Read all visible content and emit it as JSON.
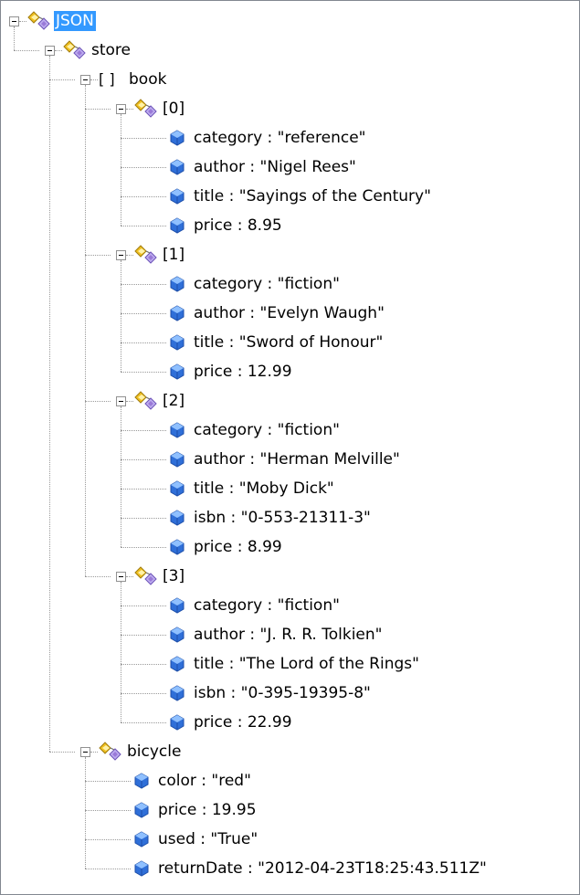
{
  "tree": {
    "root": "JSON",
    "store": "store",
    "book": "book",
    "array_glyph": "[ ]",
    "books": [
      {
        "index": "[0]",
        "props": [
          "category : \"reference\"",
          "author : \"Nigel Rees\"",
          "title : \"Sayings of the Century\"",
          "price : 8.95"
        ]
      },
      {
        "index": "[1]",
        "props": [
          "category : \"fiction\"",
          "author : \"Evelyn Waugh\"",
          "title : \"Sword of Honour\"",
          "price : 12.99"
        ]
      },
      {
        "index": "[2]",
        "props": [
          "category : \"fiction\"",
          "author : \"Herman Melville\"",
          "title : \"Moby Dick\"",
          "isbn : \"0-553-21311-3\"",
          "price : 8.99"
        ]
      },
      {
        "index": "[3]",
        "props": [
          "category : \"fiction\"",
          "author : \"J. R. R. Tolkien\"",
          "title : \"The Lord of the Rings\"",
          "isbn : \"0-395-19395-8\"",
          "price : 22.99"
        ]
      }
    ],
    "bicycle": "bicycle",
    "bicycle_props": [
      "color : \"red\"",
      "price : 19.95",
      "used : \"True\"",
      "returnDate : \"2012-04-23T18:25:43.511Z\""
    ]
  },
  "colors": {
    "selection": "#3399ff",
    "value_icon": "#2f6fd8",
    "object_icon_yellow": "#f0c020",
    "object_icon_purple": "#9a7ad8"
  },
  "icons": {
    "object": "object-icon",
    "value": "value-icon",
    "expander": "collapse-toggle"
  }
}
